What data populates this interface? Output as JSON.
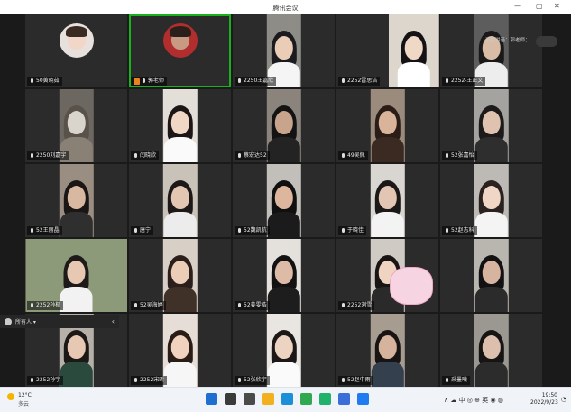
{
  "window": {
    "title": "腾讯会议",
    "controls": [
      "—",
      "▢",
      "✕"
    ]
  },
  "speaking": "正在讲话：郭老师；",
  "participants": [
    {
      "name": "50黄晓茹",
      "row": 0,
      "col": 0,
      "video": "avatar",
      "skin": "#f2d6c8",
      "hair": "#3a2a22",
      "shirt": "#e8e0dc"
    },
    {
      "name": "郭老师",
      "row": 0,
      "col": 1,
      "video": "avatar",
      "host": true,
      "active": true,
      "skin": "#c89a84",
      "hair": "#2b1f1c",
      "shirt": "#b22e2e"
    },
    {
      "name": "2250王嘉欣",
      "row": 0,
      "col": 2,
      "video": "camera",
      "skin": "#e9cdb7",
      "hair": "#1b1a1e",
      "shirt": "#f5f5f5",
      "bg": "#8e8c86"
    },
    {
      "name": "2252雷思洁",
      "row": 0,
      "col": 3,
      "video": "none"
    },
    {
      "name": "",
      "row": 0,
      "col": 3.5,
      "video": "camera",
      "skin": "#f0d8c6",
      "hair": "#141214",
      "shirt": "#ffffff",
      "bg": "#dcd6cc"
    },
    {
      "name": "2252-王正文",
      "row": 0,
      "col": 4,
      "video": "camera",
      "skin": "#d9bca6",
      "hair": "#1a1818",
      "shirt": "#ededed",
      "bg": "#5d5d5d"
    },
    {
      "name": "2250刘嘉宇",
      "row": 1,
      "col": 0,
      "video": "camera",
      "skin": "#d9d4cc",
      "hair": "#58524a",
      "shirt": "#8a8176",
      "bg": "#6d6762"
    },
    {
      "name": "闫晓欣",
      "row": 1,
      "col": 1,
      "video": "camera",
      "skin": "#f1d7c5",
      "hair": "#1d1616",
      "shirt": "#fafafa",
      "bg": "#e3dfd8"
    },
    {
      "name": "蔡宏达52",
      "row": 1,
      "col": 2,
      "video": "camera",
      "skin": "#c9a48c",
      "hair": "#131313",
      "shirt": "#232323",
      "bg": "#8b847c"
    },
    {
      "name": "49吴佩",
      "row": 1,
      "col": 3,
      "video": "camera",
      "skin": "#d9b49b",
      "hair": "#2a1d17",
      "shirt": "#3a2a22",
      "bg": "#9a8b7c"
    },
    {
      "name": "52张嘉怡",
      "row": 1,
      "col": 4,
      "video": "camera",
      "skin": "#dfc3b0",
      "hair": "#1c1a1a",
      "shirt": "#2e2e2e",
      "bg": "#a5a39f"
    },
    {
      "name": "52王丽晶",
      "row": 2,
      "col": 0,
      "video": "camera",
      "skin": "#d8b8a0",
      "hair": "#1a1616",
      "shirt": "#2f2f2f",
      "bg": "#9a8e82"
    },
    {
      "name": "唐宁",
      "row": 2,
      "col": 1,
      "video": "camera",
      "skin": "#e4c7b2",
      "hair": "#1e1919",
      "shirt": "#ececec",
      "bg": "#c9c2b9"
    },
    {
      "name": "52魏凯航",
      "row": 2,
      "col": 2,
      "video": "camera",
      "skin": "#ddb69d",
      "hair": "#101010",
      "shirt": "#1b1b1b",
      "bg": "#c2bfba"
    },
    {
      "name": "于晓佳",
      "row": 2,
      "col": 3,
      "video": "camera",
      "skin": "#e2c6b3",
      "hair": "#1b1818",
      "shirt": "#f3f3f3",
      "bg": "#d9d6d1"
    },
    {
      "name": "52赵志科",
      "row": 2,
      "col": 4,
      "video": "camera",
      "skin": "#efd6c6",
      "hair": "#2a2220",
      "shirt": "#f4f4f4",
      "bg": "#bdbab5"
    },
    {
      "name": "2252孙楷",
      "row": 3,
      "col": 0,
      "video": "wide",
      "skin": "#e7c9b3",
      "hair": "#1e1a1a",
      "shirt": "#f2f2f2",
      "bg": "#8c9a7a"
    },
    {
      "name": "52吴海婷",
      "row": 3,
      "col": 1,
      "video": "camera",
      "skin": "#eccdb8",
      "hair": "#2b1f1c",
      "shirt": "#3f3128",
      "bg": "#d8cfc6"
    },
    {
      "name": "52姜雯皓",
      "row": 3,
      "col": 2,
      "video": "camera",
      "skin": "#ddbba6",
      "hair": "#121212",
      "shirt": "#1d1d1d",
      "bg": "#e4e1dd"
    },
    {
      "name": "2252刘雪",
      "row": 3,
      "col": 3,
      "video": "camera",
      "skin": "#f0d4c2",
      "hair": "#1a1515",
      "shirt": "#2a2a2a",
      "bg": "#cfcac4",
      "sticker": true
    },
    {
      "name": "",
      "row": 3,
      "col": 4,
      "video": "camera",
      "skin": "#d6b49f",
      "hair": "#121212",
      "shirt": "#2b2b2b",
      "bg": "#b9b5af"
    },
    {
      "name": "2252孙宇",
      "row": 4,
      "col": 0,
      "video": "camera",
      "skin": "#e6c8b3",
      "hair": "#1d1818",
      "shirt": "#2a4a3e",
      "bg": "#b7b0a8"
    },
    {
      "name": "2252宋昕",
      "row": 4,
      "col": 1,
      "video": "camera",
      "skin": "#f0d2bf",
      "hair": "#2a1c16",
      "shirt": "#f6f6f6",
      "bg": "#e6ded6"
    },
    {
      "name": "52张欣宇",
      "row": 4,
      "col": 2,
      "video": "camera",
      "skin": "#ecd3c2",
      "hair": "#1c1818",
      "shirt": "#fafafa",
      "bg": "#e9e6e2"
    },
    {
      "name": "52赵中雨",
      "row": 4,
      "col": 3,
      "video": "camera",
      "skin": "#d6b39c",
      "hair": "#181414",
      "shirt": "#34404e",
      "bg": "#a79c90"
    },
    {
      "name": "采墨曦",
      "row": 4,
      "col": 4,
      "video": "camera",
      "skin": "#dcc0ad",
      "hair": "#171414",
      "shirt": "#2c2c2c",
      "bg": "#9b9892"
    }
  ],
  "chat": {
    "label": "所有人 ▾",
    "caret": "‹"
  },
  "taskbar": {
    "weather_temp": "12°C",
    "weather_desc": "多云",
    "tray": "∧ ☁ 中 ◎ ⊕ 英 ◉ ◍",
    "time": "19:50",
    "date": "2022/9/23",
    "bell": "◔",
    "icons": [
      {
        "name": "windows-start-icon",
        "color": "#1f6fd1"
      },
      {
        "name": "search-icon",
        "color": "#3a3a3a"
      },
      {
        "name": "task-view-icon",
        "color": "#4a4a4a"
      },
      {
        "name": "file-explorer-icon",
        "color": "#f2b01e"
      },
      {
        "name": "edge-browser-icon",
        "color": "#1b8fd8"
      },
      {
        "name": "chrome-icon",
        "color": "#2fa84f"
      },
      {
        "name": "app-green-icon",
        "color": "#20b26b"
      },
      {
        "name": "microsoft-store-icon",
        "color": "#3b6fd8"
      },
      {
        "name": "tencent-meeting-icon",
        "color": "#1f7cf0"
      }
    ]
  }
}
